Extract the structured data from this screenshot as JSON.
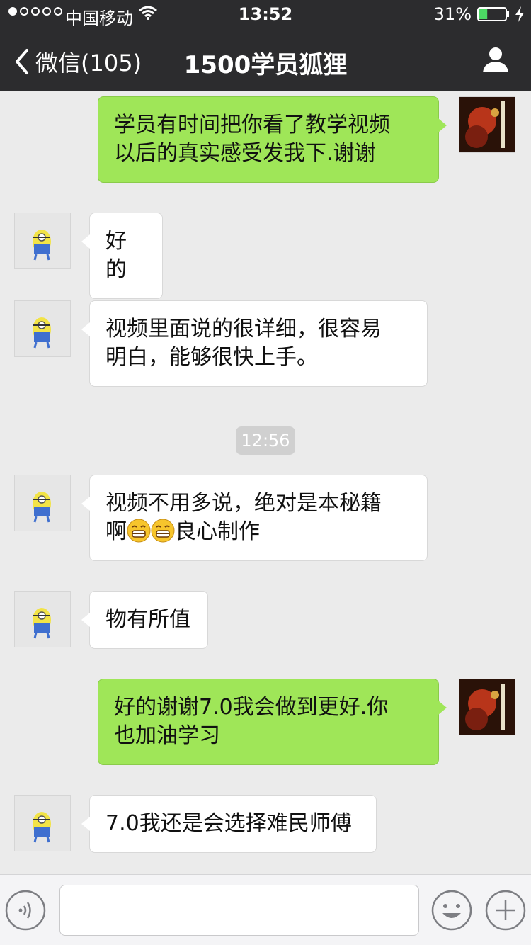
{
  "status_bar": {
    "carrier": "中国移动",
    "time": "13:52",
    "battery": "31%",
    "battery_level": 0.31
  },
  "nav": {
    "back_label": "微信(105)",
    "title": "1500学员狐狸"
  },
  "messages": [
    {
      "side": "out",
      "lines": [
        "学员有时间把你看了教学视频",
        "以后的真实感受发我下.谢谢"
      ]
    },
    {
      "side": "in",
      "lines": [
        "好的"
      ]
    },
    {
      "side": "in",
      "lines": [
        "视频里面说的很详细，很容易",
        "明白，能够很快上手。"
      ]
    },
    {
      "side": "in",
      "line1": "视频不用多说，绝对是本秘籍",
      "line2_prefix": "啊",
      "emojis": [
        "grinning-emoji",
        "grinning-emoji"
      ],
      "line2_suffix": "良心制作"
    },
    {
      "side": "in",
      "lines": [
        "物有所值"
      ]
    },
    {
      "side": "out",
      "lines": [
        "好的谢谢7.0我会做到更好.你",
        "也加油学习"
      ]
    },
    {
      "side": "in",
      "lines": [
        "7.0我还是会选择难民师傅"
      ]
    }
  ],
  "timestamp": "12:56",
  "colors": {
    "nav_bg": "#2c2c2e",
    "chat_bg": "#ebebeb",
    "outgoing_bubble": "#9fe658",
    "incoming_bubble": "#ffffff",
    "battery_fill": "#4cd964"
  },
  "icons": {
    "back": "chevron-left-icon",
    "profile": "person-icon",
    "voice": "voice-icon",
    "emoji": "smiley-icon",
    "more": "plus-icon",
    "wifi": "wifi-icon",
    "charge": "lightning-icon"
  },
  "input": {
    "value": ""
  }
}
